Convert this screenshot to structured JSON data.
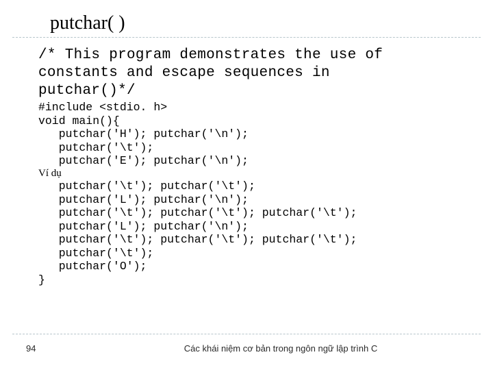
{
  "title": "putchar( )",
  "comment_l1": "/* This program demonstrates the use of",
  "comment_l2": "   constants and escape sequences in",
  "comment_l3": "   putchar()*/",
  "code": {
    "l01": "#include <stdio. h>",
    "l02": "void main(){",
    "l03": "   putchar('H'); putchar('\\n');",
    "l04": "   putchar('\\t');",
    "l05": "   putchar('E'); putchar('\\n');",
    "vidu": "Ví dụ",
    "l06": "   putchar('\\t'); putchar('\\t');",
    "l07": "   putchar('L'); putchar('\\n');",
    "l08": "   putchar('\\t'); putchar('\\t'); putchar('\\t');",
    "l09": "   putchar('L'); putchar('\\n');",
    "l10": "   putchar('\\t'); putchar('\\t'); putchar('\\t');",
    "l11": "   putchar('\\t');",
    "l12": "   putchar('O');",
    "l13": "}"
  },
  "footer": {
    "page": "94",
    "text": "Các khái niệm cơ bản trong ngôn ngữ lập trình C"
  }
}
